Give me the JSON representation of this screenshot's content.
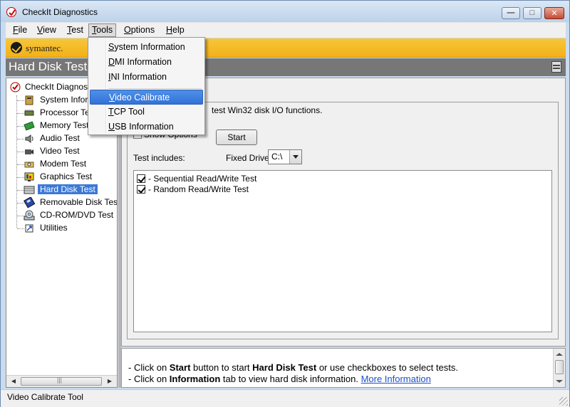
{
  "window": {
    "title": "CheckIt Diagnostics",
    "buttons": {
      "minimize": "—",
      "maximize": "□",
      "close": "✕"
    }
  },
  "menubar": {
    "items": [
      {
        "label": "File",
        "key": "F"
      },
      {
        "label": "View",
        "key": "V"
      },
      {
        "label": "Test",
        "key": "T"
      },
      {
        "label": "Tools",
        "key": "T",
        "active": true
      },
      {
        "label": "Options",
        "key": "O"
      },
      {
        "label": "Help",
        "key": "H"
      }
    ]
  },
  "brand": {
    "text": "symantec.",
    "color": "#f5bd22"
  },
  "header": {
    "title": "Hard Disk Test"
  },
  "tree": {
    "root": "CheckIt Diagnostics",
    "items": [
      {
        "label": "System Information",
        "icon": "system-info-icon"
      },
      {
        "label": "Processor Test",
        "icon": "processor-icon"
      },
      {
        "label": "Memory Test",
        "icon": "memory-icon"
      },
      {
        "label": "Audio Test",
        "icon": "speaker-icon"
      },
      {
        "label": "Video Test",
        "icon": "video-camera-icon"
      },
      {
        "label": "Modem Test",
        "icon": "modem-icon"
      },
      {
        "label": "Graphics Test",
        "icon": "graphics-icon"
      },
      {
        "label": "Hard Disk Test",
        "icon": "hard-disk-icon",
        "selected": true
      },
      {
        "label": "Removable Disk Test",
        "icon": "floppy-disk-icon"
      },
      {
        "label": "CD-ROM/DVD Test",
        "icon": "cd-rom-icon"
      },
      {
        "label": "Utilities",
        "icon": "utilities-icon"
      }
    ]
  },
  "main": {
    "description": "test Win32 disk I/O functions.",
    "show_options_label": "Show Options",
    "start_label": "Start",
    "includes_label": "Test includes:",
    "drive_label": "Fixed Drive",
    "drive_value": "C:\\",
    "tests": [
      {
        "label": "- Sequential Read/Write Test",
        "checked": true
      },
      {
        "label": "- Random Read/Write Test",
        "checked": true
      }
    ]
  },
  "info": {
    "line1_prefix": "- Click on ",
    "line1_bold1": "Start",
    "line1_mid": " button to start ",
    "line1_bold2": "Hard Disk Test",
    "line1_suffix": " or use checkboxes to select tests.",
    "line2_prefix": "- Click on ",
    "line2_bold": "Information",
    "line2_mid": " tab to view hard disk information. ",
    "line2_link": "More Information"
  },
  "status": {
    "text": "Video Calibrate Tool"
  },
  "tools_menu": {
    "items": [
      {
        "label": "System Information",
        "key": "S"
      },
      {
        "label": "DMI Information",
        "key": "D"
      },
      {
        "label": "INI Information",
        "key": "I"
      },
      {
        "label": "Video Calibrate",
        "key": "V",
        "hover": true,
        "separator_before": true
      },
      {
        "label": "TCP Tool",
        "key": "T"
      },
      {
        "label": "USB Information",
        "key": "U"
      }
    ]
  }
}
